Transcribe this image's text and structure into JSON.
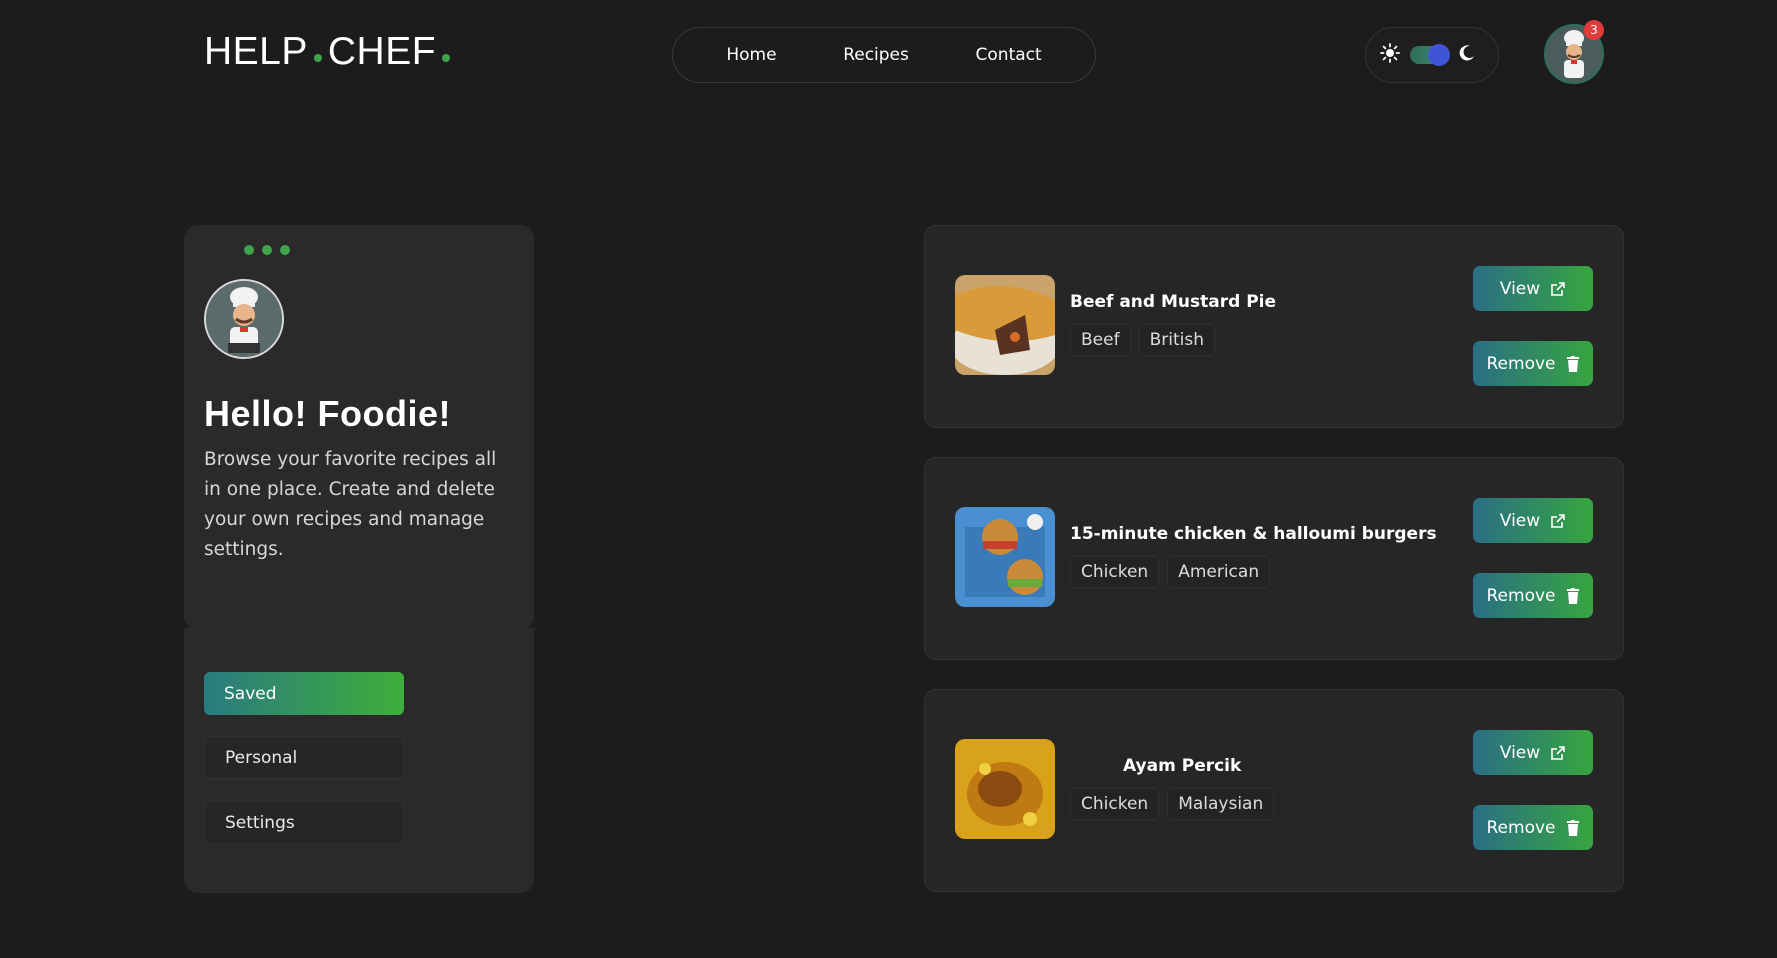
{
  "header": {
    "logo_left": "HELP",
    "logo_right": "CHEF",
    "nav": [
      "Home",
      "Recipes",
      "Contact"
    ],
    "notification_count": "3"
  },
  "profile": {
    "greeting": "Hello! Foodie!",
    "description": "Browse your favorite recipes all in one place. Create and delete your own recipes and manage settings."
  },
  "menu": {
    "items": [
      "Saved",
      "Personal",
      "Settings"
    ],
    "active": "Saved"
  },
  "recipes": [
    {
      "title": "Beef and Mustard Pie",
      "tags": [
        "Beef",
        "British"
      ],
      "view_label": "View",
      "remove_label": "Remove"
    },
    {
      "title": "15-minute chicken & halloumi burgers",
      "tags": [
        "Chicken",
        "American"
      ],
      "view_label": "View",
      "remove_label": "Remove"
    },
    {
      "title": "Ayam Percik",
      "tags": [
        "Chicken",
        "Malaysian"
      ],
      "view_label": "View",
      "remove_label": "Remove"
    }
  ],
  "colors": {
    "accent_green": "#3fa34d",
    "gradient_start": "#2a6f85",
    "gradient_end": "#37a53f",
    "badge_red": "#e03a3a",
    "toggle_knob": "#3f55d6"
  },
  "icons": [
    "sun-icon",
    "moon-icon",
    "external-link-icon",
    "trash-icon",
    "chef-avatar"
  ]
}
